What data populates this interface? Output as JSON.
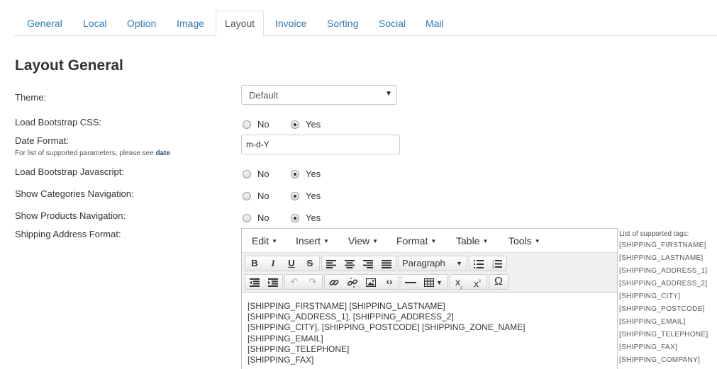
{
  "tabs": [
    "General",
    "Local",
    "Option",
    "Image",
    "Layout",
    "Invoice",
    "Sorting",
    "Social",
    "Mail"
  ],
  "active_tab": "Layout",
  "section_title": "Layout General",
  "fields": {
    "theme": {
      "label": "Theme:",
      "value": "Default"
    },
    "load_bootstrap_css": {
      "label": "Load Bootstrap CSS:",
      "no": "No",
      "yes": "Yes",
      "selected": "Yes"
    },
    "date_format": {
      "label": "Date Format:",
      "value": "m-d-Y",
      "hint": "For list of supported parameters, please see",
      "hint_link": "date"
    },
    "load_bootstrap_js": {
      "label": "Load Bootstrap Javascript:",
      "no": "No",
      "yes": "Yes",
      "selected": "Yes"
    },
    "show_categories_nav": {
      "label": "Show Categories Navigation:",
      "no": "No",
      "yes": "Yes",
      "selected": "Yes"
    },
    "show_products_nav": {
      "label": "Show Products Navigation:",
      "no": "No",
      "yes": "Yes",
      "selected": "Yes"
    },
    "shipping_address_format": {
      "label": "Shipping Address Format:"
    }
  },
  "editor": {
    "menu": [
      "Edit",
      "Insert",
      "View",
      "Format",
      "Table",
      "Tools"
    ],
    "format_select": "Paragraph",
    "content_lines": [
      "[SHIPPING_FIRSTNAME] [SHIPPING_LASTNAME]",
      "[SHIPPING_ADDRESS_1], [SHIPPING_ADDRESS_2]",
      "[SHIPPING_CITY], [SHIPPING_POSTCODE] [SHIPPING_ZONE_NAME]",
      "[SHIPPING_EMAIL]",
      "[SHIPPING_TELEPHONE]",
      "[SHIPPING_FAX]"
    ]
  },
  "supported_tags": {
    "heading": "List of supported tags:",
    "tags": [
      "[SHIPPING_FIRSTNAME]",
      "[SHIPPING_LASTNAME]",
      "[SHIPPING_ADDRESS_1]",
      "[SHIPPING_ADDRESS_2]",
      "[SHIPPING_CITY]",
      "[SHIPPING_POSTCODE]",
      "[SHIPPING_EMAIL]",
      "[SHIPPING_TELEPHONE]",
      "[SHIPPING_FAX]",
      "[SHIPPING_COMPANY]"
    ]
  }
}
